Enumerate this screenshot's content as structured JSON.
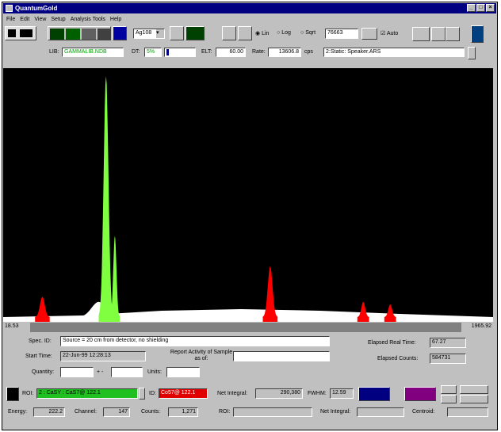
{
  "window": {
    "title": "QuantumGold"
  },
  "menu": [
    "File",
    "Edit",
    "View",
    "Setup",
    "Analysis Tools",
    "Help"
  ],
  "toolbar": {
    "detector": "Ag108",
    "scale_options": [
      "Lin",
      "Log",
      "Sqrt"
    ],
    "scale_selected": "Lin",
    "vertical_full_scale": "76663",
    "auto_label": "Auto",
    "auto_checked": true
  },
  "acquisition": {
    "lib_label": "LIB:",
    "lib_value": "GAMMALIB.NDB",
    "dt_label": "DT:",
    "dt_value": "5%",
    "elt_label": "ELT:",
    "elt_value": "60.00",
    "rate_label": "Rate:",
    "rate_value": "13606.8",
    "rate_unit": "cps",
    "static_value": "2:Static: Speaker.ARS"
  },
  "scale": {
    "min": "18.53",
    "max": "1965.92"
  },
  "spectrum": {
    "white_peaks": [
      {
        "center": 0.195,
        "height": 0.06,
        "width": 0.045
      }
    ],
    "green_peaks": [
      {
        "center": 0.21,
        "height": 0.95,
        "width": 0.015
      },
      {
        "center": 0.228,
        "height": 0.32,
        "width": 0.01
      }
    ],
    "red_peaks": [
      {
        "center": 0.08,
        "height": 0.08,
        "width": 0.015
      },
      {
        "center": 0.545,
        "height": 0.2,
        "width": 0.015
      },
      {
        "center": 0.735,
        "height": 0.06,
        "width": 0.012
      },
      {
        "center": 0.79,
        "height": 0.05,
        "width": 0.012
      }
    ]
  },
  "sample": {
    "spec_id_label": "Spec. ID:",
    "spec_id_value": "Source = 20 cm from detector, no shielding",
    "start_time_label": "Start Time:",
    "start_time_value": "22-Jun-99 12:28:13",
    "report_label": "Report Activity of Sample as of:",
    "report_value": "",
    "quantity_label": "Quantity:",
    "quantity_value": "",
    "plusminus": "+ -",
    "quantity_err_value": "",
    "units_label": "Units:",
    "units_value": "",
    "elapsed_real_label": "Elapsed Real Time:",
    "elapsed_real_value": "67.27",
    "elapsed_counts_label": "Elapsed Counts:",
    "elapsed_counts_value": "584731"
  },
  "roi": {
    "roi_label": "ROI:",
    "roi_value": "2 : CaSY : CaS7@ 122.1",
    "id_label": "ID:",
    "id_value": "Co57@ 122.1",
    "net_integral_label": "Net Integral:",
    "net_integral_value": "290,380",
    "fwhm_label": "FWHM:",
    "fwhm_value": "12.59"
  },
  "bottom": {
    "energy_label": "Energy:",
    "energy_value": "222.2",
    "channel_label": "Channel:",
    "channel_value": "147",
    "counts_label": "Counts:",
    "counts_value": "1,271",
    "roi_label": "ROI:",
    "roi_value": "",
    "net_integral_label": "Net Integral:",
    "net_integral_value": "",
    "centroid_label": "Centroid:",
    "centroid_value": ""
  },
  "colors": {
    "spectrum_bg": "#000000",
    "roi_green": "#80ff40",
    "roi_red": "#ff0000",
    "unlabeled": "#ffffff"
  }
}
